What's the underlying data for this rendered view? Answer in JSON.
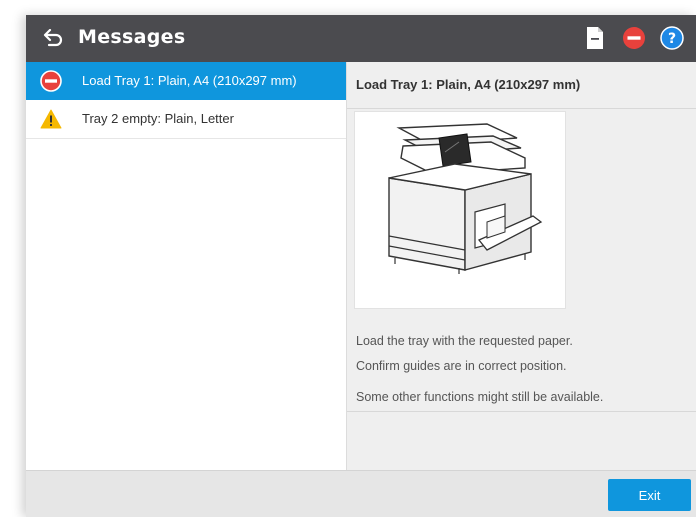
{
  "header": {
    "title": "Messages",
    "back_icon": "back-arrow-icon",
    "icons": [
      "document-icon",
      "stop-icon",
      "help-icon"
    ]
  },
  "messages": [
    {
      "label": "Load Tray 1: Plain, A4 (210x297 mm)",
      "icon": "stop-icon",
      "selected": true
    },
    {
      "label": "Tray 2 empty: Plain, Letter",
      "icon": "warning-icon",
      "selected": false
    }
  ],
  "detail": {
    "title": "Load Tray 1: Plain, A4 (210x297 mm)",
    "instructions": [
      "Load the tray with the requested paper.",
      "Confirm guides are in correct position."
    ],
    "note": "Some other functions might still be available."
  },
  "footer": {
    "exit_label": "Exit"
  },
  "colors": {
    "header_bg": "#4b4b4f",
    "accent": "#0f96dd",
    "stop_red": "#e8413c",
    "warning_yellow": "#f5b800",
    "help_blue": "#1e88e5"
  }
}
